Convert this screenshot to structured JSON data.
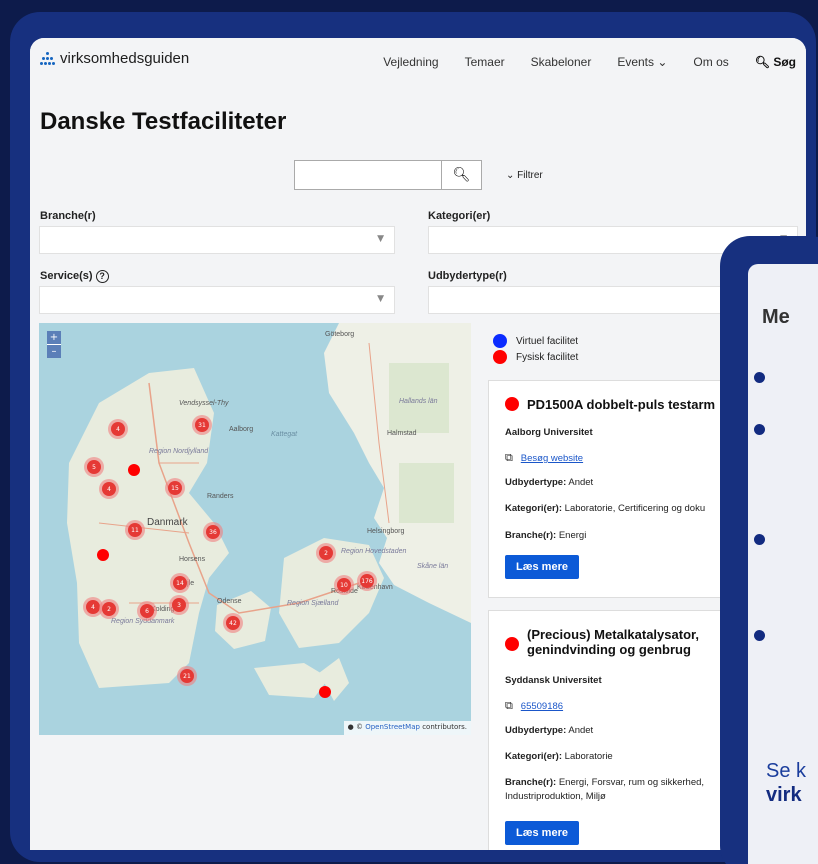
{
  "header": {
    "logo_text": "virksomhedsguiden",
    "nav": [
      "Vejledning",
      "Temaer",
      "Skabeloner",
      "Events ⌄",
      "Om os"
    ],
    "search_label": "Søg"
  },
  "page_title": "Danske Testfaciliteter",
  "search": {
    "placeholder": "",
    "filter_label": "Filtrer"
  },
  "filters": {
    "branche": "Branche(r)",
    "kategori": "Kategori(er)",
    "service": "Service(s)",
    "service_help": "?",
    "udbydertype": "Udbydertype(r)"
  },
  "map": {
    "labels": [
      "Göteborg",
      "Vendsyssel-Thy",
      "Aalborg",
      "Kattegat",
      "Region Nordjylland",
      "Hallands län",
      "Halmstad",
      "Randers",
      "Danmark",
      "Helsingborg",
      "Region Hovedstaden",
      "Skåne län",
      "Roskilde",
      "København",
      "Horsens",
      "Vejle",
      "Kolding",
      "Odense",
      "Region Sjælland",
      "Region Syddanmark"
    ],
    "clusters": [
      "4",
      "31",
      "5",
      "4",
      "15",
      "11",
      "36",
      "2",
      "10",
      "176",
      "14",
      "4",
      "2",
      "6",
      "3",
      "42",
      "21"
    ],
    "zoom_in": "+",
    "zoom_out": "–",
    "attribution_link": "OpenStreetMap",
    "attribution_text": " contributors."
  },
  "legend": {
    "virtual": "Virtuel facilitet",
    "physical": "Fysisk facilitet",
    "virtual_color": "#0b2bff",
    "physical_color": "#ff0000"
  },
  "cards": [
    {
      "title": "PD1500A dobbelt-puls testarm",
      "provider": "Aalborg Universitet",
      "link": "Besøg website",
      "udbydertype_label": "Udbydertype:",
      "udbydertype": "Andet",
      "kategori_label": "Kategori(er):",
      "kategori": "Laboratorie, Certificering og doku",
      "branche_label": "Branche(r):",
      "branche": "Energi",
      "button": "Læs mere"
    },
    {
      "title_line1": "(Precious) Metalkatalysator,",
      "title_line2": "genindvinding og genbrug",
      "provider": "Syddansk Universitet",
      "link": "65509186",
      "udbydertype_label": "Udbydertype:",
      "udbydertype": "Andet",
      "kategori_label": "Kategori(er):",
      "kategori": "Laboratorie",
      "branche_label": "Branche(r):",
      "branche": "Energi, Forsvar, rum og sikkerhed,",
      "branche2": "Industriproduktion, Miljø",
      "button": "Læs mere"
    }
  ],
  "overlay": {
    "title": "Me",
    "footer1": "Se k",
    "footer2": "virk"
  }
}
